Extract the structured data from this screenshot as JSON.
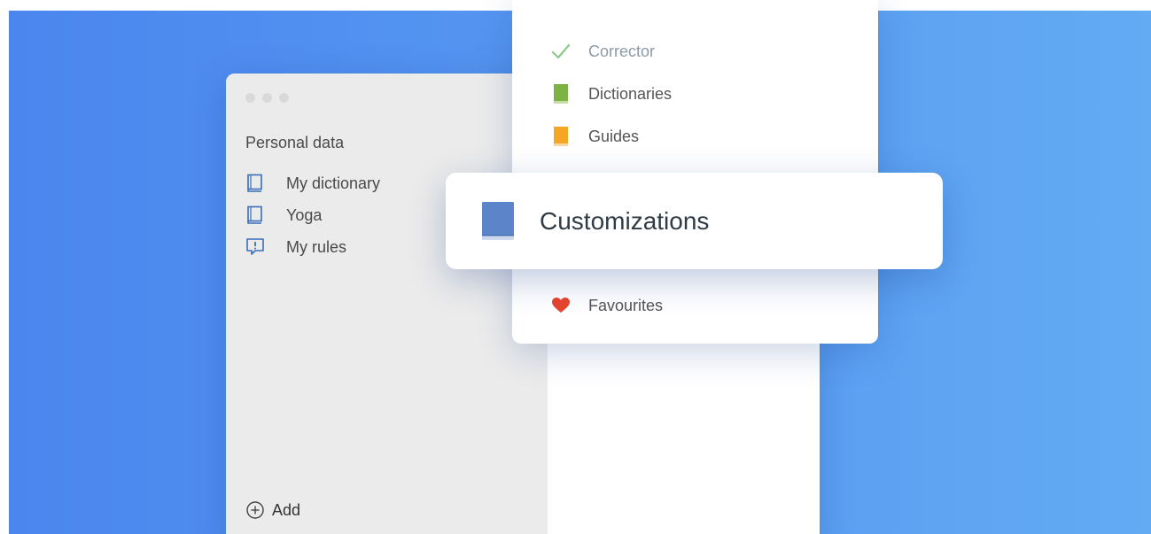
{
  "window": {
    "sidebar": {
      "section_title": "Personal data",
      "items": [
        {
          "label": "My dictionary",
          "icon": "book-outline-icon"
        },
        {
          "label": "Yoga",
          "icon": "book-outline-icon"
        },
        {
          "label": "My rules",
          "icon": "exclamation-bubble-icon"
        }
      ],
      "add_label": "Add"
    }
  },
  "menu": {
    "items": [
      {
        "label": "Corrector",
        "icon": "checkmark-icon",
        "color": "#8bc88a"
      },
      {
        "label": "Dictionaries",
        "icon": "green-book-icon",
        "color": "#7cb342"
      },
      {
        "label": "Guides",
        "icon": "orange-book-icon",
        "color": "#f5a623"
      },
      {
        "label": "Favourites",
        "icon": "heart-icon",
        "color": "#e8452c"
      }
    ],
    "highlighted": {
      "label": "Customizations",
      "icon": "blue-book-icon",
      "color": "#5b84c9"
    }
  },
  "colors": {
    "background_start": "#4a86ee",
    "background_end": "#63abf3",
    "icon_blue": "#3a6fb8"
  }
}
